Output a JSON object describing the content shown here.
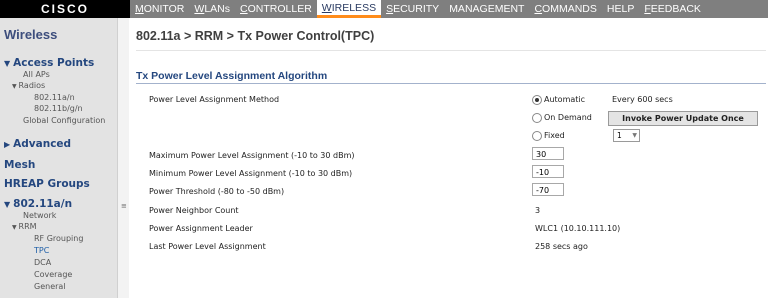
{
  "header": {
    "logo": "CISCO",
    "menu": [
      {
        "u": "M",
        "rest": "ONITOR"
      },
      {
        "u": "W",
        "rest": "LANs"
      },
      {
        "u": "C",
        "rest": "ONTROLLER"
      },
      {
        "u": "W",
        "rest": "IRELESS"
      },
      {
        "u": "S",
        "rest": "ECURITY"
      },
      {
        "u": "",
        "rest": "MANAGEMENT"
      },
      {
        "u": "C",
        "rest": "OMMANDS"
      },
      {
        "u": "",
        "rest": "HELP"
      },
      {
        "u": "F",
        "rest": "EEDBACK"
      }
    ]
  },
  "sidebar": {
    "title": "Wireless",
    "access_points": "Access Points",
    "all_aps": "All APs",
    "radios": "Radios",
    "radio_a": "802.11a/n",
    "radio_bg": "802.11b/g/n",
    "global_config": "Global Configuration",
    "advanced": "Advanced",
    "mesh": "Mesh",
    "hreap": "HREAP Groups",
    "band": "802.11a/n",
    "network": "Network",
    "rrm": "RRM",
    "rf_grouping": "RF Grouping",
    "tpc": "TPC",
    "dca": "DCA",
    "coverage": "Coverage",
    "general": "General"
  },
  "main": {
    "breadcrumb": "802.11a > RRM > Tx Power Control(TPC)",
    "section_title": "Tx Power Level Assignment Algorithm",
    "method_label": "Power Level Assignment Method",
    "automatic": "Automatic",
    "every": "Every 600 secs",
    "on_demand": "On Demand",
    "invoke_button": "Invoke Power Update Once",
    "fixed": "Fixed",
    "fixed_value": "1",
    "max_label": "Maximum Power Level Assignment (-10 to 30 dBm)",
    "max_value": "30",
    "min_label": "Minimum Power Level Assignment (-10 to 30 dBm)",
    "min_value": "-10",
    "threshold_label": "Power Threshold (-80 to -50 dBm)",
    "threshold_value": "-70",
    "neighbor_label": "Power Neighbor Count",
    "neighbor_value": "3",
    "leader_label": "Power Assignment Leader",
    "leader_value": "WLC1 (10.10.111.10)",
    "last_label": "Last Power Level Assignment",
    "last_value": "258 secs ago"
  },
  "colors": {
    "nav_bg": "#7f7f7f",
    "active_tab_underline": "#ff8c1a",
    "link_blue": "#24477f"
  }
}
